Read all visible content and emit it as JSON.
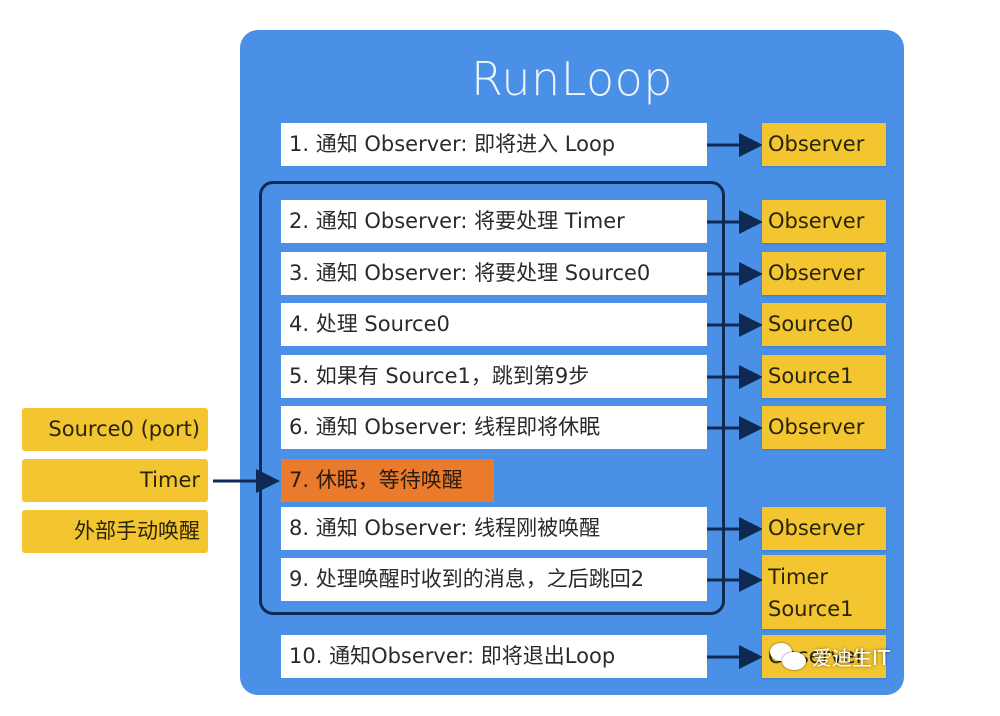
{
  "title": "RunLoop",
  "steps": [
    {
      "label": "1. 通知 Observer: 即将进入 Loop",
      "target": "Observer"
    },
    {
      "label": "2. 通知 Observer: 将要处理 Timer",
      "target": "Observer"
    },
    {
      "label": "3. 通知 Observer: 将要处理 Source0",
      "target": "Observer"
    },
    {
      "label": "4. 处理 Source0",
      "target": "Source0"
    },
    {
      "label": "5. 如果有 Source1，跳到第9步",
      "target": "Source1"
    },
    {
      "label": "6. 通知 Observer: 线程即将休眠",
      "target": "Observer"
    },
    {
      "label": "7. 休眠，等待唤醒",
      "target": null
    },
    {
      "label": "8. 通知 Observer: 线程刚被唤醒",
      "target": "Observer"
    },
    {
      "label": "9. 处理唤醒时收到的消息，之后跳回2",
      "target_lines": [
        "Timer",
        "Source1"
      ]
    },
    {
      "label": "10. 通知Observer: 即将退出Loop",
      "target": "Observer"
    }
  ],
  "wake_sources": [
    "Source0 (port)",
    "Timer",
    "外部手动唤醒"
  ],
  "watermark": "爱迪生IT",
  "colors": {
    "panel": "#4a90e6",
    "step_box": "#ffffff",
    "sleep_step": "#ea7a2c",
    "tag": "#f3c531",
    "arrow": "#0e2a52"
  }
}
